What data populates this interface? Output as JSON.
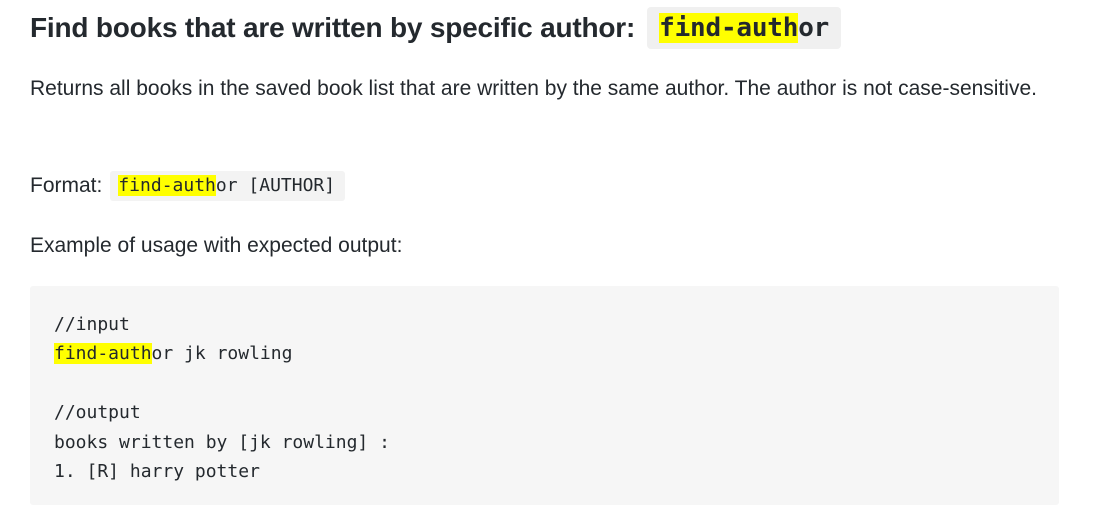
{
  "heading": {
    "text": "Find books that are written by specific author:",
    "command_highlight": "find-auth",
    "command_rest": "or"
  },
  "description": "Returns all books in the saved book list that are written by the same author. The author is not case-sensitive.",
  "format": {
    "label": "Format:",
    "command_highlight": "find-auth",
    "command_rest": "or [AUTHOR]"
  },
  "example_label": "Example of usage with expected output:",
  "code_block": {
    "input_comment": "//input",
    "input_highlight": "find-auth",
    "input_rest": "or jk rowling",
    "output_comment": "//output",
    "output_line1": "books written by [jk rowling] :",
    "output_line2": "1. [R] harry potter"
  },
  "colors": {
    "highlight": "#ffff00",
    "code_background": "#f6f6f6",
    "text": "#24292e"
  }
}
